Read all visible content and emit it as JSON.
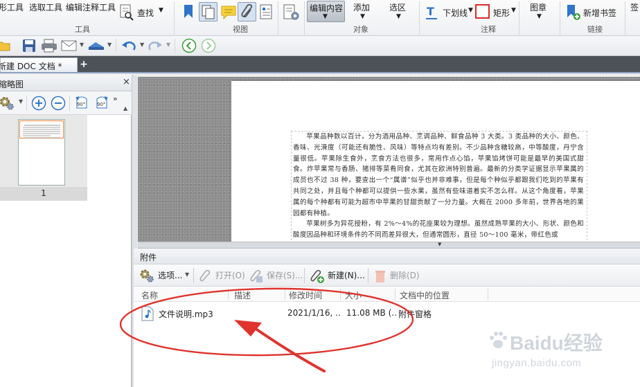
{
  "ribbon": {
    "tools_group": {
      "label": "工具",
      "items": [
        "形工具",
        "选取工具",
        "编辑注释工具"
      ],
      "find_label": "查找"
    },
    "view_group": {
      "label": "视图"
    },
    "object_group": {
      "label": "对象",
      "edit_content": "编辑内容",
      "add": "添加",
      "select_area": "选区"
    },
    "comment_group": {
      "label": "注释",
      "underline": "下划线",
      "rectangle": "矩形"
    },
    "stamp_label": "图章",
    "link_group": {
      "label": "链接",
      "new_bookmark": "新增书签",
      "more": "签"
    }
  },
  "tabbar": {
    "doc_tab": "新建 DOC 文档 *",
    "new_tab_symbol": "+"
  },
  "thumbnails": {
    "title": "缩略图",
    "close_symbol": "×",
    "rotate_left_label": "90°",
    "rotate_right_label": "90°",
    "page_number": "1"
  },
  "document": {
    "paragraphs": [
      "苹果品种数以百计，分为酒用品种、烹调品种、鲜食品种 3 大类。3 类品种的大小、颜色、香味、光滑度（可能还有脆性、风味）等特点均有差别。不少品种含糖较高，中等酸度，丹宁含量很低。苹果除生食外，烹食方法也很多，常用作点心馅，苹果馅烤饼可能是最早的美国式甜食。炸苹果常与香肠、猪排等菜肴同食，尤其在欧洲特别普遍。最新的分类学证据显示苹果属的成员也不过 38 种，要查出一个“属谱”似乎也并非难事，但是每个种似乎都跟我们吃到的苹果有共同之处，并且每个种都可以提供一些水果，虽然有些味道着实不怎么样。从这个角度看，苹果属的每个种都有可能为超市中苹果的甘甜贡献了一分力量。大概在 2000 多年前，世界各地的果园都有种植。",
      "苹果树多为异花授粉，有 2%～4%的花座果较为理想。虽然成熟苹果的大小、形状、颜色和酸度因品种和环境条件的不同而差异很大，但通常圆形，直径 50～100 毫米，带红色或"
    ]
  },
  "attachments": {
    "title": "附件",
    "toolbar": {
      "options": "选项...",
      "open": "打开(O)",
      "save": "保存(S)...",
      "new": "新建(N)...",
      "delete": "删除(D)"
    },
    "columns": [
      "名称",
      "描述",
      "修改时间",
      "大小",
      "文档中的位置"
    ],
    "rows": [
      {
        "name": "文件说明.mp3",
        "description": "",
        "modified": "2021/1/16, ..",
        "size": "11.08 MB (..",
        "location": "附件窗格"
      }
    ]
  },
  "watermark": {
    "brand": "Baidu经验",
    "url": "jingyan.baidu.com"
  },
  "colors": {
    "annotation_red": "#e0332e",
    "tab_bar": "#4d5258",
    "thumbnail_selection": "#e8833a",
    "accent_blue": "#2f74c9"
  }
}
